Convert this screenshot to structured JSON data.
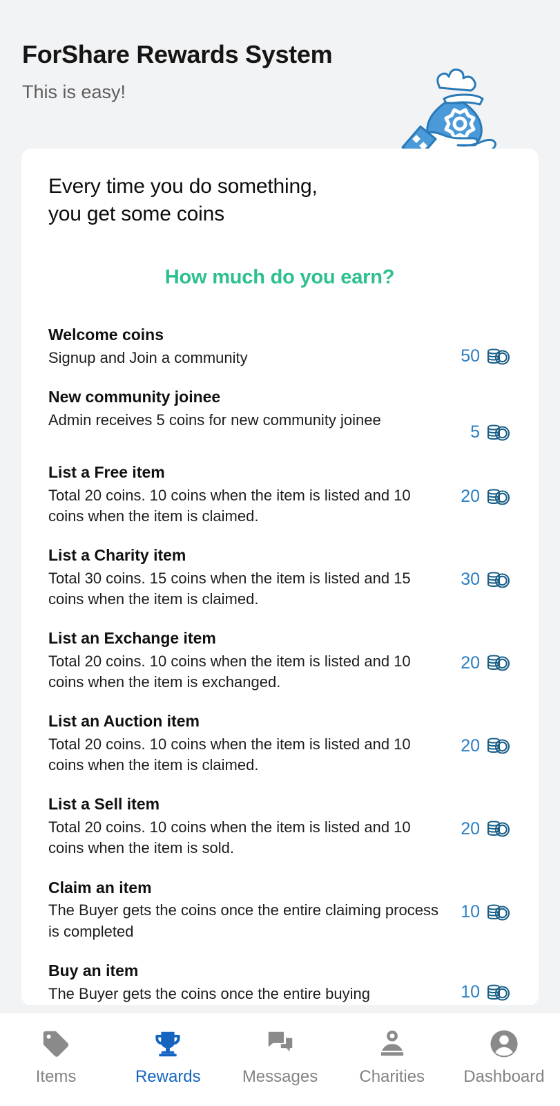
{
  "header": {
    "title": "ForShare Rewards System",
    "subtitle": "This is easy!",
    "illustration_icon": "money-bag-in-hand-icon"
  },
  "card": {
    "heading_line1": "Every time you do something,",
    "heading_line2": "you get some coins",
    "question": "How much do you earn?",
    "coin_icon": "coin-stack-icon"
  },
  "rewards": [
    {
      "title": "Welcome coins",
      "description": "Signup and Join a community",
      "amount": "50"
    },
    {
      "title": "New community joinee",
      "description": "Admin receives 5 coins for new community joinee",
      "amount": "5"
    },
    {
      "title": "List a Free item",
      "description": "Total 20 coins. 10 coins when the item is listed and 10 coins when the item is claimed.",
      "amount": "20"
    },
    {
      "title": "List a Charity item",
      "description": "Total 30 coins. 15 coins when the item is listed and 15 coins when the item is claimed.",
      "amount": "30"
    },
    {
      "title": "List an Exchange item",
      "description": "Total 20 coins. 10 coins when the item is listed and 10 coins when the item is exchanged.",
      "amount": "20"
    },
    {
      "title": "List an Auction item",
      "description": "Total 20 coins. 10 coins when the item is listed and 10 coins when the item is claimed.",
      "amount": "20"
    },
    {
      "title": "List a Sell item",
      "description": "Total 20 coins. 10 coins when the item is listed and 10 coins when the item is sold.",
      "amount": "20"
    },
    {
      "title": "Claim an item",
      "description": "The Buyer gets the coins once the entire claiming process is completed",
      "amount": "10"
    },
    {
      "title": "Buy an item",
      "description": "The Buyer gets the coins once the entire buying",
      "amount": "10"
    }
  ],
  "bottom_nav": {
    "items": [
      {
        "label": "Items",
        "icon": "tag-icon",
        "active": false
      },
      {
        "label": "Rewards",
        "icon": "trophy-icon",
        "active": true
      },
      {
        "label": "Messages",
        "icon": "chat-bubbles-icon",
        "active": false
      },
      {
        "label": "Charities",
        "icon": "donation-hand-icon",
        "active": false
      },
      {
        "label": "Dashboard",
        "icon": "account-circle-icon",
        "active": false
      }
    ]
  },
  "colors": {
    "background": "#f2f3f5",
    "card": "#ffffff",
    "accent_green": "#2dc08d",
    "accent_blue": "#2b7fc4",
    "coin_outline": "#1a5f86",
    "nav_active": "#1565c0",
    "nav_inactive": "#838383",
    "illustration_blue": "#4a9ad9"
  }
}
